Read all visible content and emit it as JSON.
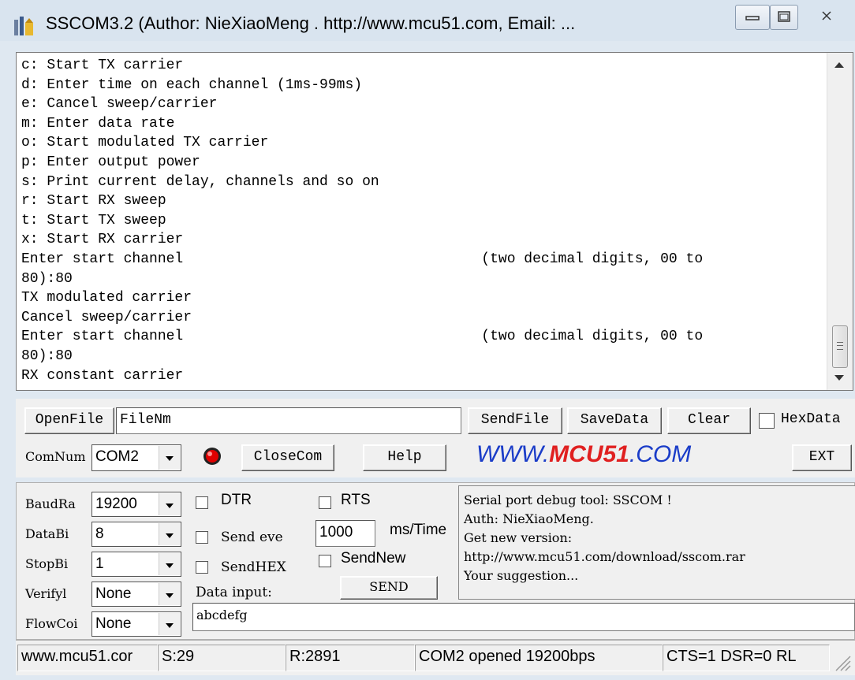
{
  "window": {
    "title": "SSCOM3.2 (Author: NieXiaoMeng . http://www.mcu51.com, Email: ..."
  },
  "output": {
    "lines": [
      "c: Start TX carrier",
      "d: Enter time on each channel (1ms-99ms)",
      "e: Cancel sweep/carrier",
      "m: Enter data rate",
      "o: Start modulated TX carrier",
      "p: Enter output power",
      "s: Print current delay, channels and so on",
      "r: Start RX sweep",
      "t: Start TX sweep",
      "x: Start RX carrier",
      "Enter start channel                                   (two decimal digits, 00 to",
      "80):80",
      "TX modulated carrier",
      "Cancel sweep/carrier",
      "Enter start channel                                   (two decimal digits, 00 to",
      "80):80",
      "RX constant carrier"
    ]
  },
  "file_row": {
    "open_file_label": "OpenFile",
    "file_name_value": "FileNm",
    "send_file_label": "SendFile",
    "save_data_label": "SaveData",
    "clear_label": "Clear",
    "hex_data_label": "HexData"
  },
  "com_row": {
    "com_num_label": "ComNum",
    "com_port_value": "COM2",
    "close_com_label": "CloseCom",
    "help_label": "Help",
    "brand_prefix": "WWW.",
    "brand_name": "MCU51",
    "brand_suffix": ".COM",
    "ext_label": "EXT",
    "status_light_color": "#e00000",
    "brand_color": "#1a3cc8",
    "brand_accent_color": "#e02020"
  },
  "settings": {
    "baud_label": "BaudRa",
    "baud_value": "19200",
    "data_bits_label": "DataBi",
    "data_bits_value": "8",
    "stop_bits_label": "StopBi",
    "stop_bits_value": "1",
    "verify_label": "Verifyl",
    "verify_value": "None",
    "flow_label": "FlowCoi",
    "flow_value": "None"
  },
  "options": {
    "dtr_label": "DTR",
    "rts_label": "RTS",
    "send_every_label": "Send eve",
    "interval_value": "1000",
    "interval_unit": "ms/Time",
    "send_hex_label": "SendHEX",
    "send_new_label": "SendNew",
    "data_input_label": "Data input:",
    "send_button_label": "SEND",
    "data_input_value": "abcdefg"
  },
  "info": {
    "lines": [
      "Serial port debug tool: SSCOM !",
      "Auth: NieXiaoMeng.",
      "Get new version:",
      "http://www.mcu51.com/download/sscom.rar",
      "Your suggestion..."
    ]
  },
  "statusbar": {
    "site": "www.mcu51.cor",
    "sent": "S:29",
    "received": "R:2891",
    "port_status": "COM2 opened 19200bps",
    "line_status": "CTS=1 DSR=0 RL"
  }
}
